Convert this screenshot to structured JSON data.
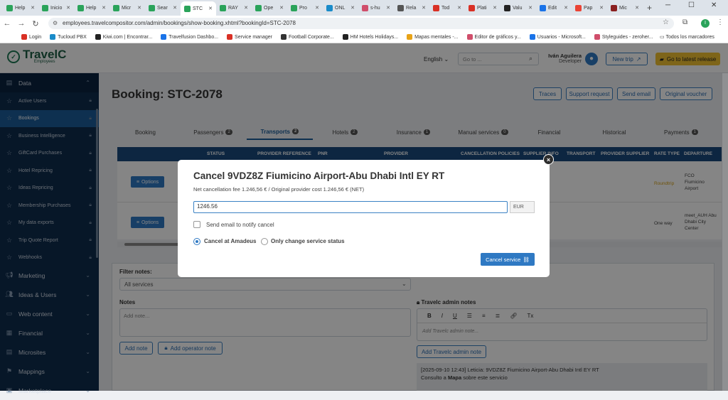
{
  "browser": {
    "tabs": [
      {
        "label": "Help",
        "color": "#2aa35a"
      },
      {
        "label": "Inicio",
        "color": "#2aa35a"
      },
      {
        "label": "Help",
        "color": "#2aa35a"
      },
      {
        "label": "Micr",
        "color": "#2aa35a"
      },
      {
        "label": "Sear",
        "color": "#2aa35a"
      },
      {
        "label": "STC",
        "color": "#2aa35a"
      },
      {
        "label": "RAY",
        "color": "#2aa35a"
      },
      {
        "label": "Ope",
        "color": "#2aa35a"
      },
      {
        "label": "Pro",
        "color": "#2aa35a"
      },
      {
        "label": "ONL",
        "color": "#1a8bc9"
      },
      {
        "label": "s-hu",
        "color": "#d04e6b"
      },
      {
        "label": "Rela",
        "color": "#555555"
      },
      {
        "label": "Tod",
        "color": "#d93025"
      },
      {
        "label": "Plati",
        "color": "#d93025"
      },
      {
        "label": "Valu",
        "color": "#222222"
      },
      {
        "label": "Edit",
        "color": "#1a73e8"
      },
      {
        "label": "Pap",
        "color": "#ea4335"
      },
      {
        "label": "Mic",
        "color": "#8a1f1f"
      }
    ],
    "active_tab_index": 5,
    "new_tab": "+",
    "url": "employees.travelcompositor.com/admin/bookings/show-booking.xhtml?bookingId=STC-2078",
    "bookmarks": [
      "Login",
      "Tucloud PBX",
      "Kiwi.com | Encontrar...",
      "Travelfusion Dashbo...",
      "Service manager",
      "Football Corporate...",
      "HM Hotels Holidays...",
      "Mapas mentales -...",
      "Editor de gráficos y...",
      "Usuarios - Microsoft...",
      "Styleguides - zeroher..."
    ],
    "all_bookmarks": "Todos los marcadores",
    "profile_initial": "I"
  },
  "header": {
    "logo_text": "TravelC",
    "logo_sub": "Employees",
    "language": "English",
    "search_placeholder": "Go to ...",
    "user_name": "Iván Aguilera",
    "user_role": "Developer",
    "new_trip": "New trip",
    "latest_release": "Go to latest release"
  },
  "sidebar": {
    "section": "Data",
    "items": [
      {
        "label": "Active Users"
      },
      {
        "label": "Bookings",
        "active": true
      },
      {
        "label": "Business Intelligence"
      },
      {
        "label": "GiftCard Purchases"
      },
      {
        "label": "Hotel Repricing"
      },
      {
        "label": "Ideas Repricing"
      },
      {
        "label": "Membership Purchases"
      },
      {
        "label": "My data exports"
      },
      {
        "label": "Trip Quote Report"
      },
      {
        "label": "Webhooks"
      }
    ],
    "groups": [
      {
        "label": "Marketing"
      },
      {
        "label": "Ideas & Users"
      },
      {
        "label": "Web content"
      },
      {
        "label": "Financial"
      },
      {
        "label": "Microsites"
      },
      {
        "label": "Mappings"
      },
      {
        "label": "Marketplace"
      }
    ]
  },
  "page": {
    "title": "Booking: STC-2078",
    "actions": [
      "Traces",
      "Support request",
      "Send email",
      "Original voucher"
    ],
    "tabs": [
      {
        "label": "Booking",
        "badge": ""
      },
      {
        "label": "Passengers",
        "badge": "2"
      },
      {
        "label": "Transports",
        "badge": "2",
        "active": true
      },
      {
        "label": "Hotels",
        "badge": "2"
      },
      {
        "label": "Insurance",
        "badge": "1"
      },
      {
        "label": "Manual services",
        "badge": "0"
      },
      {
        "label": "Financial",
        "badge": ""
      },
      {
        "label": "Historical",
        "badge": ""
      },
      {
        "label": "Payments",
        "badge": "1"
      }
    ],
    "table_headers": [
      "STATUS",
      "PROVIDER REFERENCE",
      "PNR",
      "PROVIDER",
      "CANCELLATION POLICIES",
      "SUPPLIER INFO",
      "TRANSPORT",
      "PROVIDER SUPPLIER",
      "RATE TYPE",
      "DEPARTURE"
    ],
    "options_label": "Options",
    "rows": [
      {
        "rate_type": "Roundtrip",
        "departure": "FCO Fiumicino Airport"
      },
      {
        "rate_type": "One way",
        "departure": "meet_AUH Abu Dhabi City Center"
      }
    ],
    "filter_notes_label": "Filter notes:",
    "filter_notes_value": "All services",
    "notes_label": "Notes",
    "notes_placeholder": "Add note...",
    "add_note": "Add note",
    "add_operator_note": "Add operator note",
    "admin_notes_label": "Travelc admin notes",
    "admin_notes_placeholder": "Add Travelc admin note...",
    "add_admin_note": "Add Travelc admin note",
    "note_entry_line1": "[2025-09-10 12:43] Leticia: 9VDZ8Z Fiumicino Airport-Abu Dhabi Intl EY RT",
    "note_entry_prefix": "Consulto a ",
    "note_entry_bold": "Mapa",
    "note_entry_suffix": " sobre este servicio"
  },
  "modal": {
    "title": "Cancel 9VDZ8Z Fiumicino Airport-Abu Dhabi Intl EY RT",
    "subtitle": "Net cancellation fee 1.246,56 € / Original provider cost 1.246,56 € (NET)",
    "amount_value": "1246.56",
    "currency": "EUR",
    "send_email_label": "Send email to notify cancel",
    "radio_amadeus": "Cancel at Amadeus",
    "radio_status": "Only change service status",
    "cancel_button": "Cancel service",
    "close": "×"
  }
}
